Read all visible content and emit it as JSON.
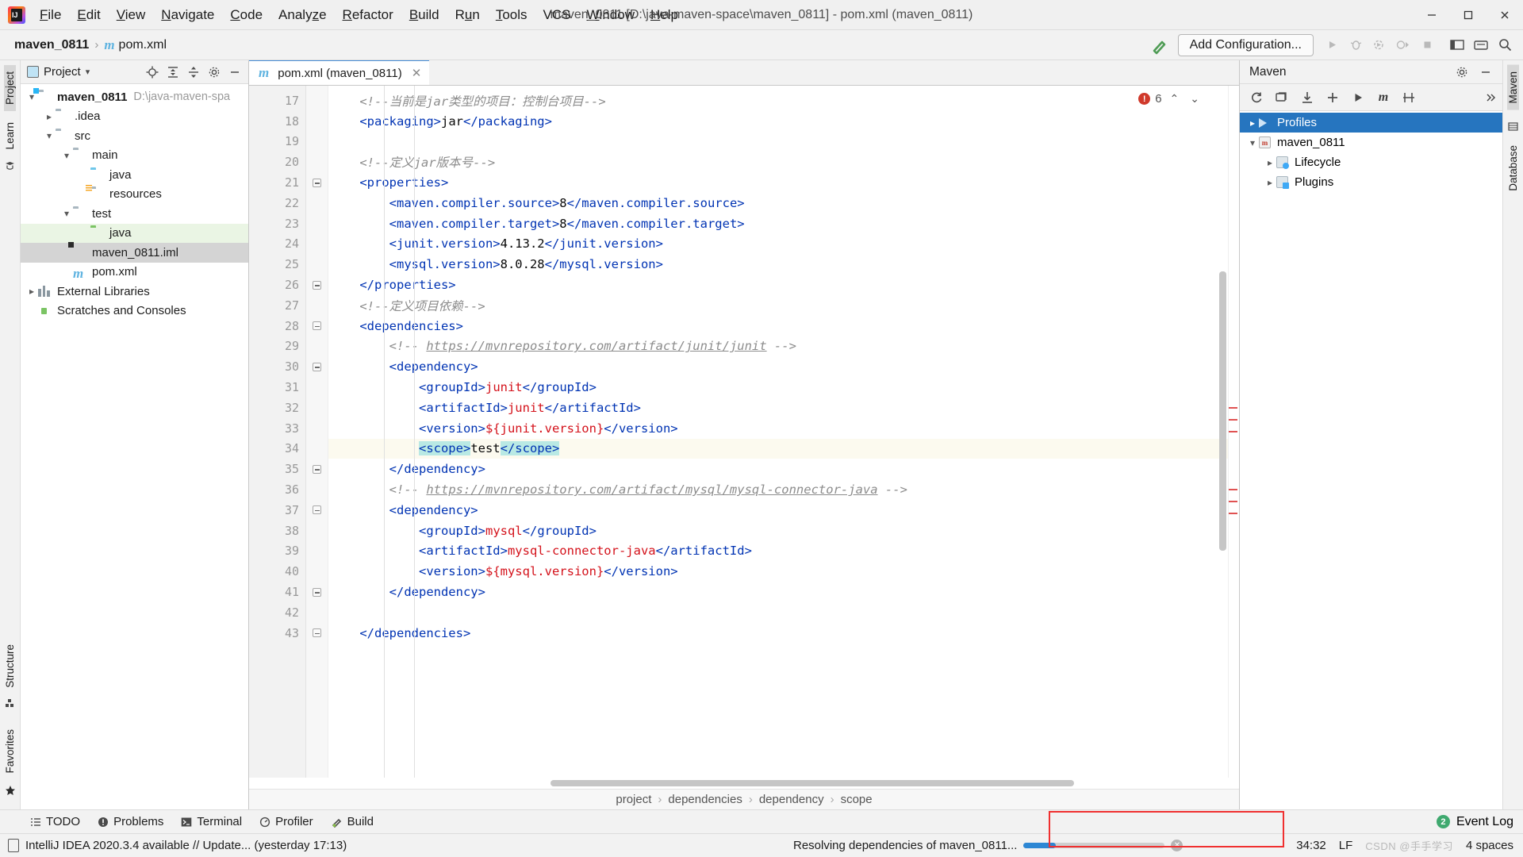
{
  "window": {
    "title": "maven_0811 [D:\\java-maven-space\\maven_0811] - pom.xml (maven_0811)",
    "minimize": "—",
    "maximize": "☐",
    "close": "✕"
  },
  "menubar": [
    {
      "label": "File",
      "mnemonic": "F"
    },
    {
      "label": "Edit",
      "mnemonic": "E"
    },
    {
      "label": "View",
      "mnemonic": "V"
    },
    {
      "label": "Navigate",
      "mnemonic": "N"
    },
    {
      "label": "Code",
      "mnemonic": "C"
    },
    {
      "label": "Analyze",
      "mnemonic": "z"
    },
    {
      "label": "Refactor",
      "mnemonic": "R"
    },
    {
      "label": "Build",
      "mnemonic": "B"
    },
    {
      "label": "Run",
      "mnemonic": "u"
    },
    {
      "label": "Tools",
      "mnemonic": "T"
    },
    {
      "label": "VCS",
      "mnemonic": ""
    },
    {
      "label": "Window",
      "mnemonic": "W"
    },
    {
      "label": "Help",
      "mnemonic": "H"
    }
  ],
  "navbar": {
    "project": "maven_0811",
    "separator": "›",
    "file": "pom.xml",
    "file_icon": "maven-m-icon",
    "add_configuration": "Add Configuration...",
    "build_icon": "hammer-icon",
    "run_icon": "run-icon",
    "debug_icon": "debug-icon",
    "coverage_icon": "run-coverage-icon",
    "profile_icon": "profile-icon",
    "stop_icon": "stop-icon",
    "search_icon": "search-icon",
    "layout_icon": "layout-icon",
    "updates_icon": "updates-icon"
  },
  "left_strip": {
    "project_label": "Project",
    "learn_label": "Learn",
    "structure_label": "Structure",
    "favorites_label": "Favorites"
  },
  "right_strip": {
    "maven_label": "Maven",
    "database_label": "Database"
  },
  "project_panel": {
    "title": "Project",
    "toolbar": [
      "locate-icon",
      "collapse-all-icon",
      "expand-icon",
      "gear-icon",
      "hide-icon"
    ],
    "tree": [
      {
        "label": "maven_0811",
        "path": "D:\\java-maven-spa",
        "depth": 0,
        "arrow": "v",
        "icon": "folder-module",
        "bold": true,
        "state": "none"
      },
      {
        "label": ".idea",
        "path": "",
        "depth": 1,
        "arrow": ">",
        "icon": "folder",
        "bold": false,
        "state": "none"
      },
      {
        "label": "src",
        "path": "",
        "depth": 1,
        "arrow": "v",
        "icon": "folder",
        "bold": false,
        "state": "none"
      },
      {
        "label": "main",
        "path": "",
        "depth": 2,
        "arrow": "v",
        "icon": "folder",
        "bold": false,
        "state": "none"
      },
      {
        "label": "java",
        "path": "",
        "depth": 3,
        "arrow": "",
        "icon": "folder-blue",
        "bold": false,
        "state": "none"
      },
      {
        "label": "resources",
        "path": "",
        "depth": 3,
        "arrow": "",
        "icon": "folder-resources",
        "bold": false,
        "state": "none"
      },
      {
        "label": "test",
        "path": "",
        "depth": 2,
        "arrow": "v",
        "icon": "folder",
        "bold": false,
        "state": "none"
      },
      {
        "label": "java",
        "path": "",
        "depth": 3,
        "arrow": "",
        "icon": "folder-green",
        "bold": false,
        "state": "green"
      },
      {
        "label": "maven_0811.iml",
        "path": "",
        "depth": 2,
        "arrow": "",
        "icon": "file-iml",
        "bold": false,
        "state": "grey"
      },
      {
        "label": "pom.xml",
        "path": "",
        "depth": 2,
        "arrow": "",
        "icon": "maven-m-icon",
        "bold": false,
        "state": "none"
      },
      {
        "label": "External Libraries",
        "path": "",
        "depth": 0,
        "arrow": ">",
        "icon": "libraries-icon",
        "bold": false,
        "state": "none"
      },
      {
        "label": "Scratches and Consoles",
        "path": "",
        "depth": 0,
        "arrow": "",
        "icon": "scratches-icon",
        "bold": false,
        "state": "none"
      }
    ]
  },
  "editor": {
    "tab": {
      "label": "pom.xml (maven_0811)",
      "icon": "maven-m-icon",
      "close": "✕"
    },
    "error_count": "6",
    "error_icon": "error-icon",
    "nav_up": "⌃",
    "nav_down": "⌄",
    "first_line": 17,
    "lines": [
      {
        "n": 17,
        "fold": false,
        "hl": false,
        "spans": [
          {
            "t": "    ",
            "c": "txt"
          },
          {
            "t": "<!--当前是jar类型的项目：控制台项目-->",
            "c": "cmt"
          }
        ]
      },
      {
        "n": 18,
        "fold": false,
        "hl": false,
        "spans": [
          {
            "t": "    ",
            "c": "txt"
          },
          {
            "t": "<packaging>",
            "c": "tag"
          },
          {
            "t": "jar",
            "c": "txt"
          },
          {
            "t": "</packaging>",
            "c": "tag"
          }
        ]
      },
      {
        "n": 19,
        "fold": false,
        "hl": false,
        "spans": []
      },
      {
        "n": 20,
        "fold": false,
        "hl": false,
        "spans": [
          {
            "t": "    ",
            "c": "txt"
          },
          {
            "t": "<!--定义jar版本号-->",
            "c": "cmt"
          }
        ]
      },
      {
        "n": 21,
        "fold": true,
        "hl": false,
        "spans": [
          {
            "t": "    ",
            "c": "txt"
          },
          {
            "t": "<properties>",
            "c": "tag"
          }
        ]
      },
      {
        "n": 22,
        "fold": false,
        "hl": false,
        "spans": [
          {
            "t": "        ",
            "c": "txt"
          },
          {
            "t": "<maven.compiler.source>",
            "c": "tag"
          },
          {
            "t": "8",
            "c": "txt"
          },
          {
            "t": "</maven.compiler.source>",
            "c": "tag"
          }
        ]
      },
      {
        "n": 23,
        "fold": false,
        "hl": false,
        "spans": [
          {
            "t": "        ",
            "c": "txt"
          },
          {
            "t": "<maven.compiler.target>",
            "c": "tag"
          },
          {
            "t": "8",
            "c": "txt"
          },
          {
            "t": "</maven.compiler.target>",
            "c": "tag"
          }
        ]
      },
      {
        "n": 24,
        "fold": false,
        "hl": false,
        "spans": [
          {
            "t": "        ",
            "c": "txt"
          },
          {
            "t": "<junit.version>",
            "c": "tag"
          },
          {
            "t": "4.13.2",
            "c": "txt"
          },
          {
            "t": "</junit.version>",
            "c": "tag"
          }
        ]
      },
      {
        "n": 25,
        "fold": false,
        "hl": false,
        "spans": [
          {
            "t": "        ",
            "c": "txt"
          },
          {
            "t": "<mysql.version>",
            "c": "tag"
          },
          {
            "t": "8.0.28",
            "c": "txt"
          },
          {
            "t": "</mysql.version>",
            "c": "tag"
          }
        ]
      },
      {
        "n": 26,
        "fold": true,
        "hl": false,
        "spans": [
          {
            "t": "    ",
            "c": "txt"
          },
          {
            "t": "</properties>",
            "c": "tag"
          }
        ]
      },
      {
        "n": 27,
        "fold": false,
        "hl": false,
        "spans": [
          {
            "t": "    ",
            "c": "txt"
          },
          {
            "t": "<!--定义项目依赖-->",
            "c": "cmt"
          }
        ]
      },
      {
        "n": 28,
        "fold": true,
        "hl": false,
        "spans": [
          {
            "t": "    ",
            "c": "txt"
          },
          {
            "t": "<dependencies>",
            "c": "tag"
          }
        ]
      },
      {
        "n": 29,
        "fold": false,
        "hl": false,
        "spans": [
          {
            "t": "        ",
            "c": "txt"
          },
          {
            "t": "<!-- ",
            "c": "cmt"
          },
          {
            "t": "https://mvnrepository.com/artifact/junit/junit",
            "c": "lnk"
          },
          {
            "t": " -->",
            "c": "cmt"
          }
        ]
      },
      {
        "n": 30,
        "fold": true,
        "hl": false,
        "spans": [
          {
            "t": "        ",
            "c": "txt"
          },
          {
            "t": "<dependency>",
            "c": "tag"
          }
        ]
      },
      {
        "n": 31,
        "fold": false,
        "hl": false,
        "spans": [
          {
            "t": "            ",
            "c": "txt"
          },
          {
            "t": "<groupId>",
            "c": "tag"
          },
          {
            "t": "junit",
            "c": "val"
          },
          {
            "t": "</groupId>",
            "c": "tag"
          }
        ]
      },
      {
        "n": 32,
        "fold": false,
        "hl": false,
        "spans": [
          {
            "t": "            ",
            "c": "txt"
          },
          {
            "t": "<artifactId>",
            "c": "tag"
          },
          {
            "t": "junit",
            "c": "val"
          },
          {
            "t": "</artifactId>",
            "c": "tag"
          }
        ]
      },
      {
        "n": 33,
        "fold": false,
        "hl": false,
        "spans": [
          {
            "t": "            ",
            "c": "txt"
          },
          {
            "t": "<version>",
            "c": "tag"
          },
          {
            "t": "${junit.version}",
            "c": "val"
          },
          {
            "t": "</version>",
            "c": "tag"
          }
        ]
      },
      {
        "n": 34,
        "fold": false,
        "hl": true,
        "spans": [
          {
            "t": "            ",
            "c": "txt"
          },
          {
            "t": "<scope>",
            "c": "tag sel-hl"
          },
          {
            "t": "test",
            "c": "txt"
          },
          {
            "t": "</scope>",
            "c": "tag sel-hl"
          }
        ]
      },
      {
        "n": 35,
        "fold": true,
        "hl": false,
        "spans": [
          {
            "t": "        ",
            "c": "txt"
          },
          {
            "t": "</dependency>",
            "c": "tag"
          }
        ]
      },
      {
        "n": 36,
        "fold": false,
        "hl": false,
        "spans": [
          {
            "t": "        ",
            "c": "txt"
          },
          {
            "t": "<!-- ",
            "c": "cmt"
          },
          {
            "t": "https://mvnrepository.com/artifact/mysql/mysql-connector-java",
            "c": "lnk"
          },
          {
            "t": " -->",
            "c": "cmt"
          }
        ]
      },
      {
        "n": 37,
        "fold": true,
        "hl": false,
        "spans": [
          {
            "t": "        ",
            "c": "txt"
          },
          {
            "t": "<dependency>",
            "c": "tag"
          }
        ]
      },
      {
        "n": 38,
        "fold": false,
        "hl": false,
        "spans": [
          {
            "t": "            ",
            "c": "txt"
          },
          {
            "t": "<groupId>",
            "c": "tag"
          },
          {
            "t": "mysql",
            "c": "val"
          },
          {
            "t": "</groupId>",
            "c": "tag"
          }
        ]
      },
      {
        "n": 39,
        "fold": false,
        "hl": false,
        "spans": [
          {
            "t": "            ",
            "c": "txt"
          },
          {
            "t": "<artifactId>",
            "c": "tag"
          },
          {
            "t": "mysql-connector-java",
            "c": "val"
          },
          {
            "t": "</artifactId>",
            "c": "tag"
          }
        ]
      },
      {
        "n": 40,
        "fold": false,
        "hl": false,
        "spans": [
          {
            "t": "            ",
            "c": "txt"
          },
          {
            "t": "<version>",
            "c": "tag"
          },
          {
            "t": "${mysql.version}",
            "c": "val"
          },
          {
            "t": "</version>",
            "c": "tag"
          }
        ]
      },
      {
        "n": 41,
        "fold": true,
        "hl": false,
        "spans": [
          {
            "t": "        ",
            "c": "txt"
          },
          {
            "t": "</dependency>",
            "c": "tag"
          }
        ]
      },
      {
        "n": 42,
        "fold": false,
        "hl": false,
        "spans": []
      },
      {
        "n": 43,
        "fold": true,
        "hl": false,
        "spans": [
          {
            "t": "    ",
            "c": "txt"
          },
          {
            "t": "</dependencies>",
            "c": "tag"
          }
        ]
      }
    ],
    "breadcrumbs": [
      "project",
      "dependencies",
      "dependency",
      "scope"
    ],
    "breadcrumb_sep": "›"
  },
  "maven_panel": {
    "title": "Maven",
    "toolbar": [
      "reload-icon",
      "reload-all-icon",
      "download-sources-icon",
      "add-icon",
      "run-icon",
      "maven-goal-icon",
      "toggle-offline-icon",
      "more-icon"
    ],
    "settings_icon": "gear-icon",
    "hide_icon": "hide-icon",
    "tree": [
      {
        "label": "Profiles",
        "depth": 0,
        "arrow": ">",
        "icon": "profiles-icon",
        "selected": true
      },
      {
        "label": "maven_0811",
        "depth": 0,
        "arrow": "v",
        "icon": "maven-project-icon",
        "selected": false
      },
      {
        "label": "Lifecycle",
        "depth": 1,
        "arrow": ">",
        "icon": "lifecycle-icon",
        "selected": false
      },
      {
        "label": "Plugins",
        "depth": 1,
        "arrow": ">",
        "icon": "plugins-icon",
        "selected": false
      }
    ]
  },
  "toolwindow_bar": {
    "items": [
      {
        "label": "TODO",
        "icon": "todo-icon"
      },
      {
        "label": "Problems",
        "icon": "problems-icon"
      },
      {
        "label": "Terminal",
        "icon": "terminal-icon"
      },
      {
        "label": "Profiler",
        "icon": "profiler-icon"
      },
      {
        "label": "Build",
        "icon": "build-icon"
      }
    ],
    "event_log": {
      "label": "Event Log",
      "count": "2",
      "icon": "event-log-icon"
    }
  },
  "statusbar": {
    "message": "IntelliJ IDEA 2020.3.4 available // Update... (yesterday 17:13)",
    "message_icon": "ide-update-icon",
    "progress_text": "Resolving dependencies of maven_0811...",
    "progress_percent": 23,
    "cancel_icon": "cancel-icon",
    "caret_position": "34:32",
    "line_separator": "LF",
    "indent": "4 spaces",
    "watermark": "CSDN @⼿⼿学习"
  },
  "colors": {
    "accent_blue": "#2675bf",
    "error_red": "#d0392b",
    "highlight_yellow": "#fcfaef",
    "selection_teal": "#b9e9e4",
    "tab_active_border": "#4a90d9",
    "tree_green": "#eaf5e4",
    "tree_grey": "#d4d4d4",
    "progress_blue": "#2d87d4",
    "red_annotation": "#f03030"
  }
}
